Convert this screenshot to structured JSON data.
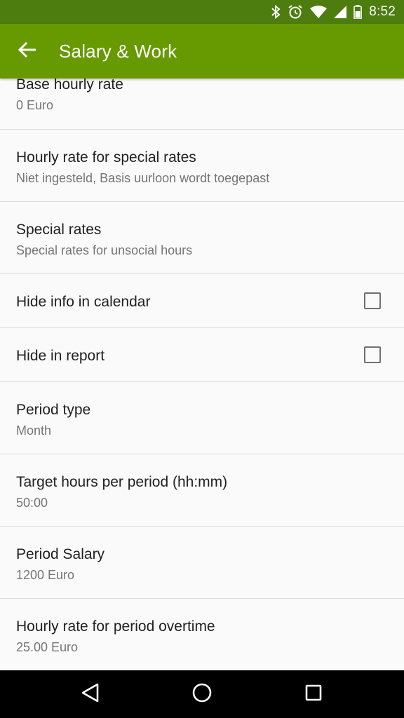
{
  "status_bar": {
    "time": "8:52",
    "icons": [
      "bluetooth-icon",
      "alarm-icon",
      "wifi-icon",
      "cellular-signal-icon",
      "battery-icon"
    ]
  },
  "app_bar": {
    "title": "Salary & Work",
    "back_icon": "arrow-left-icon"
  },
  "settings": [
    {
      "title": "Base hourly rate",
      "subtitle": "0 Euro"
    },
    {
      "title": "Hourly rate for special rates",
      "subtitle": "Niet ingesteld, Basis uurloon wordt toegepast"
    },
    {
      "title": "Special rates",
      "subtitle": "Special rates for unsocial hours"
    },
    {
      "title": "Hide info in calendar",
      "checked": false
    },
    {
      "title": "Hide in report",
      "checked": false
    },
    {
      "title": "Period type",
      "subtitle": "Month"
    },
    {
      "title": "Target hours per period (hh:mm)",
      "subtitle": "50:00"
    },
    {
      "title": "Period Salary",
      "subtitle": "1200 Euro"
    },
    {
      "title": "Hourly rate for period overtime",
      "subtitle": "25.00 Euro"
    }
  ],
  "nav_bar": {
    "icons": [
      "back-triangle-icon",
      "home-circle-icon",
      "recents-square-icon"
    ]
  },
  "colors": {
    "status_bar": "#4d7c0f",
    "app_bar": "#669a00",
    "background": "#fafafa",
    "divider": "#dcdcdc",
    "primary_text": "#212121",
    "secondary_text": "#757575"
  }
}
